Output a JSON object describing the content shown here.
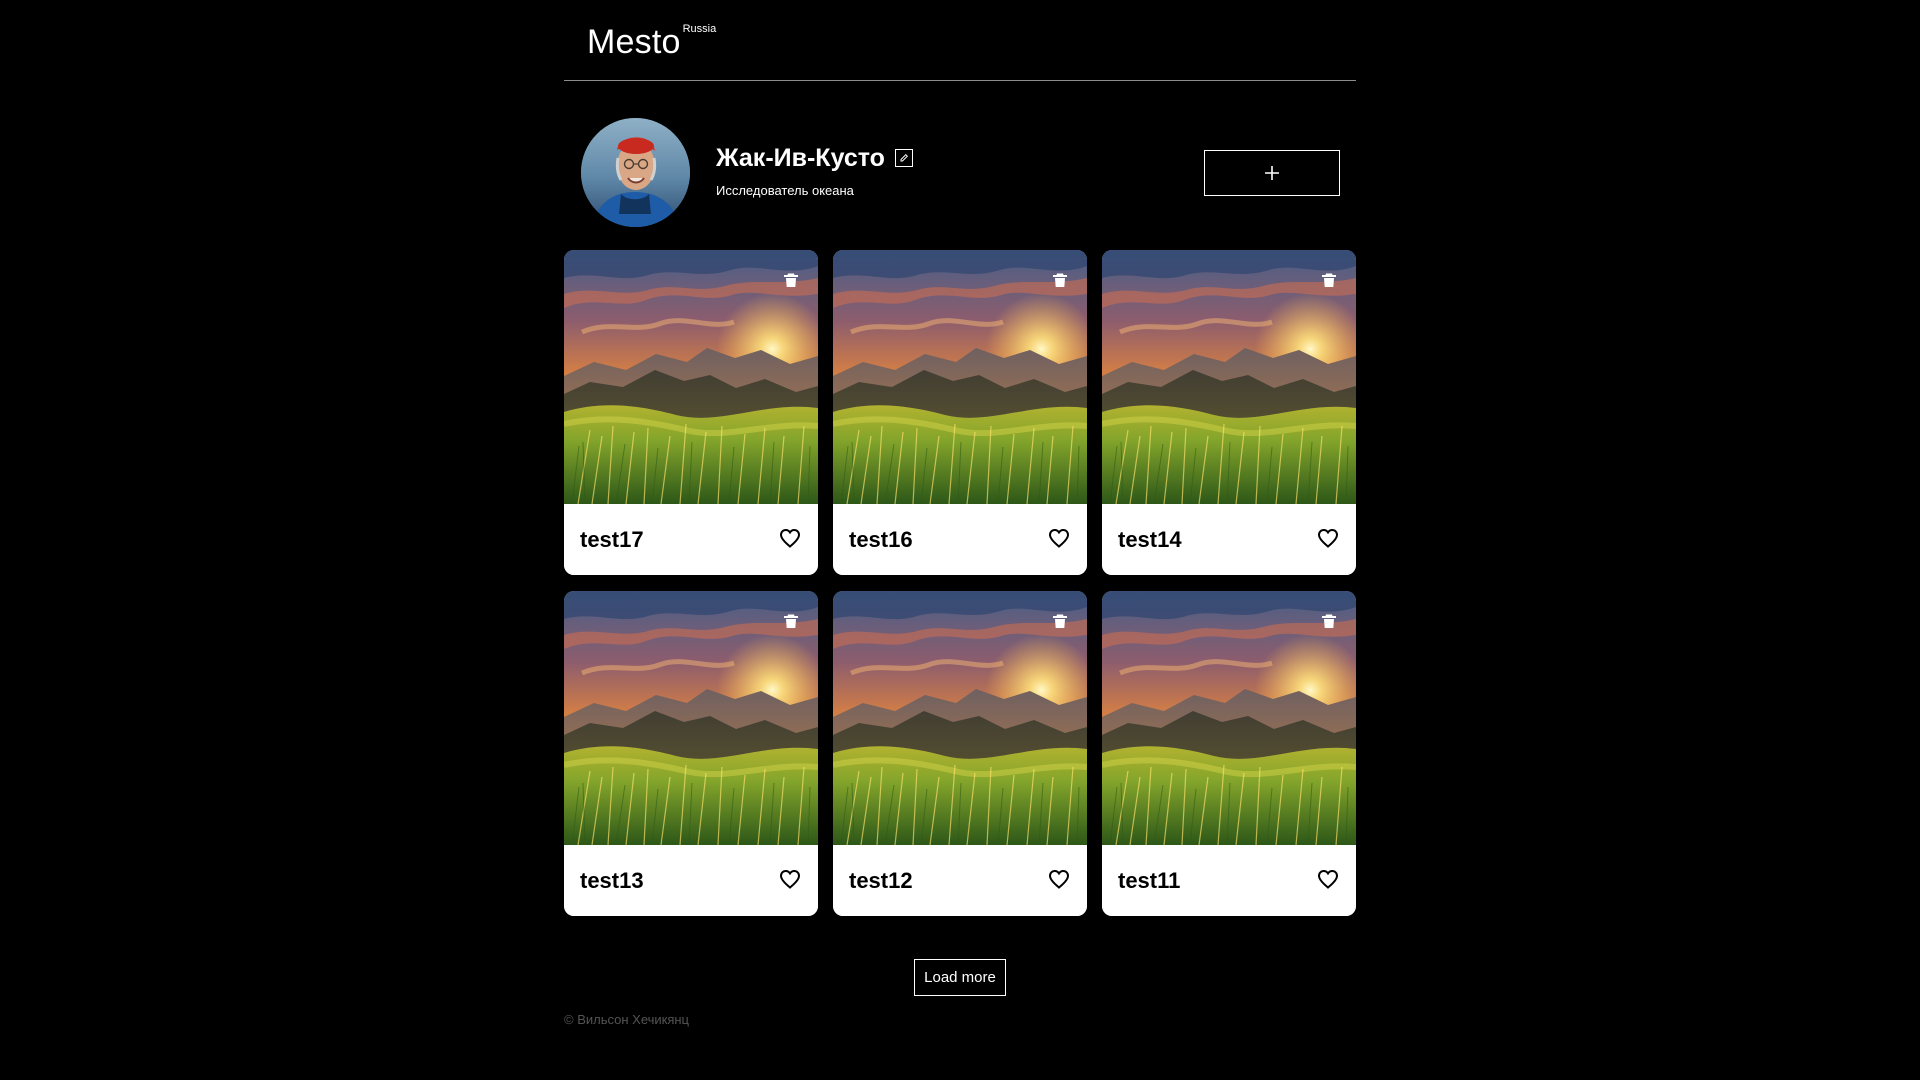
{
  "header": {
    "logo": "Mesto",
    "logo_sup": "Russia"
  },
  "profile": {
    "name": "Жак-Ив-Кусто",
    "about": "Исследователь океана",
    "edit_icon": "edit-icon",
    "add_icon": "plus-icon"
  },
  "cards": [
    {
      "title": "test17"
    },
    {
      "title": "test16"
    },
    {
      "title": "test14"
    },
    {
      "title": "test13"
    },
    {
      "title": "test12"
    },
    {
      "title": "test11"
    }
  ],
  "actions": {
    "load_more": "Load more"
  },
  "footer": {
    "copyright": "© Вильсон Хечикянц"
  },
  "colors": {
    "background": "#000000",
    "card_background": "#ffffff",
    "text": "#ffffff",
    "footer_text": "#545454"
  }
}
